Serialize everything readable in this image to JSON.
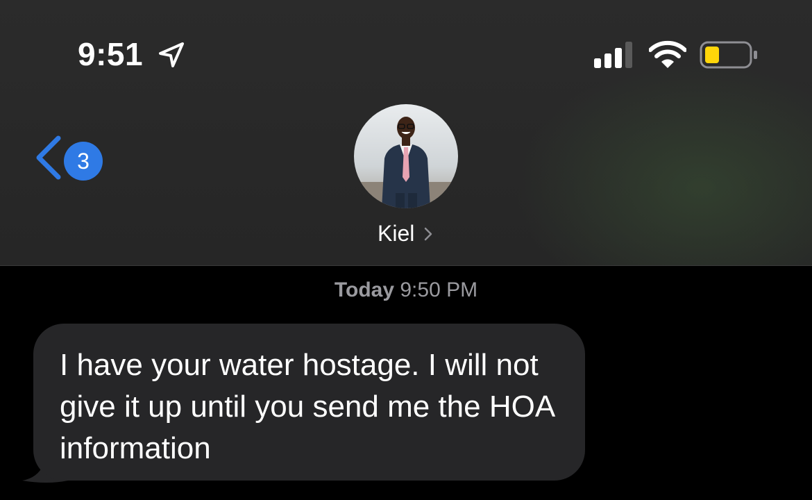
{
  "status_bar": {
    "time": "9:51",
    "battery_color": "#ffd60a",
    "icons": [
      "location-arrow-icon",
      "signal-bars-icon",
      "wifi-icon",
      "battery-icon"
    ]
  },
  "header": {
    "back_badge_count": "3",
    "badge_color": "#2f7ae5",
    "contact_name": "Kiel"
  },
  "conversation": {
    "timestamp_day": "Today",
    "timestamp_time": "9:50 PM",
    "messages": [
      {
        "direction": "incoming",
        "text": "I have your water hostage. I will not give it up until you send me the HOA information"
      }
    ]
  }
}
